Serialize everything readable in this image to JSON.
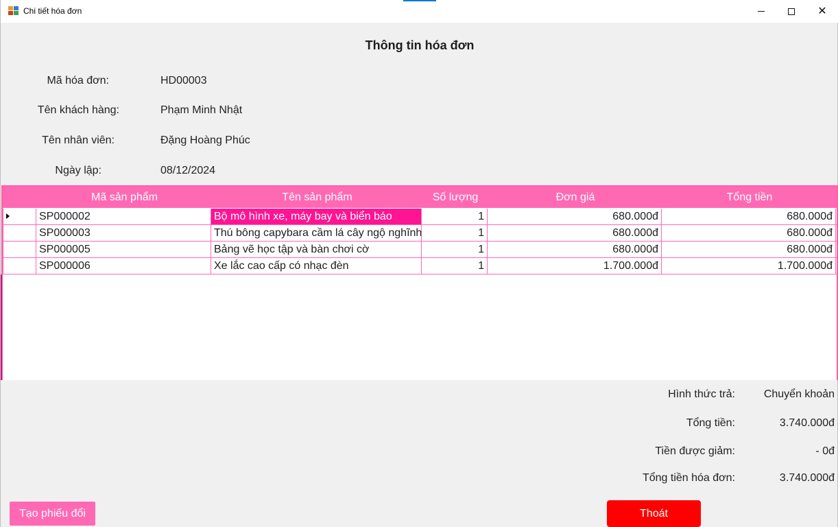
{
  "window": {
    "title": "Chi tiết hóa đơn"
  },
  "heading": "Thông tin hóa đơn",
  "info": {
    "ma_hoa_don_label": "Mã hóa đơn:",
    "ma_hoa_don_value": "HD00003",
    "ten_khach_hang_label": "Tên khách hàng:",
    "ten_khach_hang_value": "Phạm Minh Nhật",
    "ten_nhan_vien_label": "Tên nhân viên:",
    "ten_nhan_vien_value": "Đặng Hoàng Phúc",
    "ngay_lap_label": "Ngày lập:",
    "ngay_lap_value": "08/12/2024"
  },
  "grid": {
    "columns": [
      "Mã sản phẩm",
      "Tên sản phẩm",
      "Số lượng",
      "Đơn giá",
      "Tổng tiền"
    ],
    "rows": [
      [
        "SP000002",
        "Bộ mô hình xe, máy bay và biển báo",
        "1",
        "680.000đ",
        "680.000đ"
      ],
      [
        "SP000003",
        "Thú bông capybara cầm lá cây ngộ nghĩnh",
        "1",
        "680.000đ",
        "680.000đ"
      ],
      [
        "SP000005",
        "Bảng vẽ học tập và bàn chơi cờ",
        "1",
        "680.000đ",
        "680.000đ"
      ],
      [
        "SP000006",
        "Xe lắc cao cấp có nhạc đèn",
        "1",
        "1.700.000đ",
        "1.700.000đ"
      ]
    ]
  },
  "summary": {
    "hinh_thuc_tra_label": "Hình thức trả:",
    "hinh_thuc_tra_value": "Chuyển khoản",
    "tong_tien_label": "Tổng tiền:",
    "tong_tien_value": "3.740.000đ",
    "tien_duoc_giam_label": "Tiền được giảm:",
    "tien_duoc_giam_value": "- 0đ",
    "tong_tien_hoa_don_label": "Tổng tiền hóa đơn:",
    "tong_tien_hoa_don_value": "3.740.000đ"
  },
  "buttons": {
    "tao_phieu_doi": "Tạo phiếu đổi",
    "thoat": "Thoát"
  },
  "colors": {
    "accent_pink": "#ff69b4",
    "selected_pink": "#ff1493",
    "exit_red": "#ff0000"
  }
}
